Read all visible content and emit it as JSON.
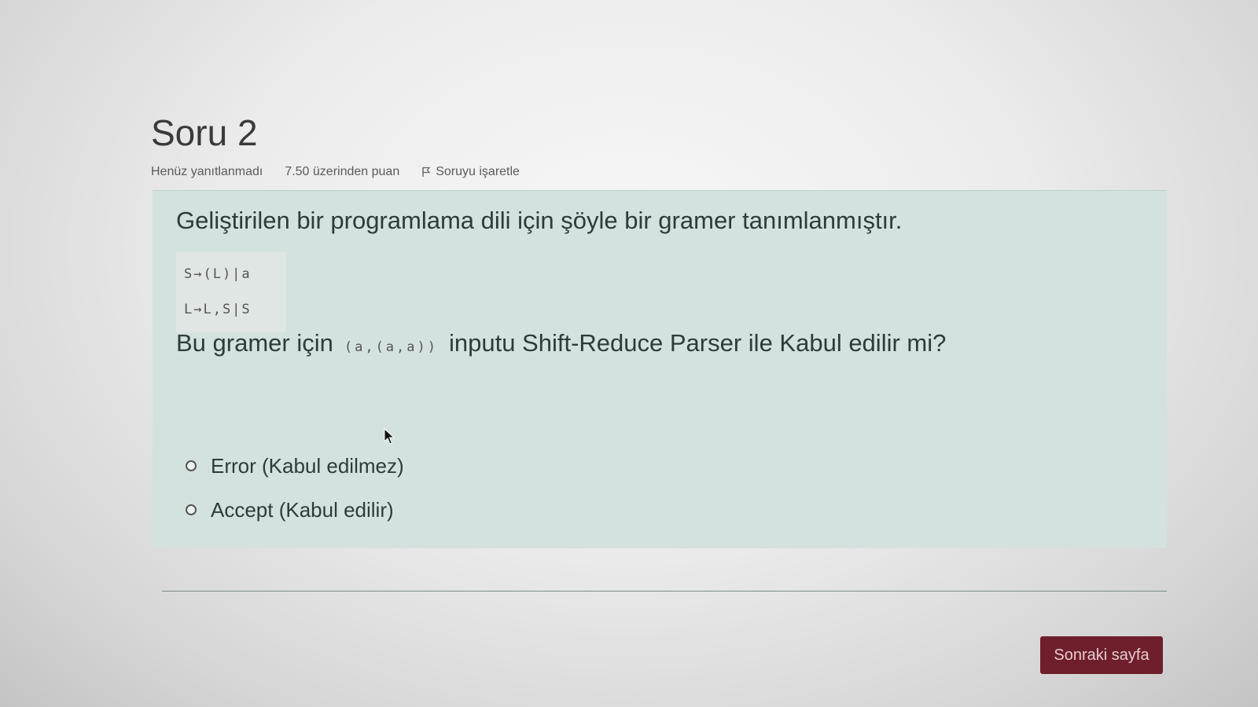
{
  "question": {
    "title": "Soru 2",
    "status": "Henüz yanıtlanmadı",
    "points": "7.50 üzerinden puan",
    "flag_label": "Soruyu işaretle",
    "intro": "Geliştirilen bir programlama dili için şöyle bir gramer tanımlanmıştır.",
    "grammar": [
      "S→(L)|a",
      "L→L,S|S"
    ],
    "prompt_before": "Bu gramer için",
    "input_code": "(a,(a,a))",
    "prompt_after": "inputu Shift-Reduce Parser ile Kabul edilir mi?"
  },
  "answers": [
    {
      "label": "Error (Kabul edilmez)",
      "selected": false
    },
    {
      "label": "Accept (Kabul edilir)",
      "selected": false
    }
  ],
  "navigation": {
    "next_label": "Sonraki sayfa"
  },
  "colors": {
    "question_box": "#d3e2df",
    "next_button": "#6e1f2b"
  },
  "icons": {
    "flag": "flag-icon",
    "cursor": "mouse-pointer-icon",
    "radio": "radio-button"
  }
}
